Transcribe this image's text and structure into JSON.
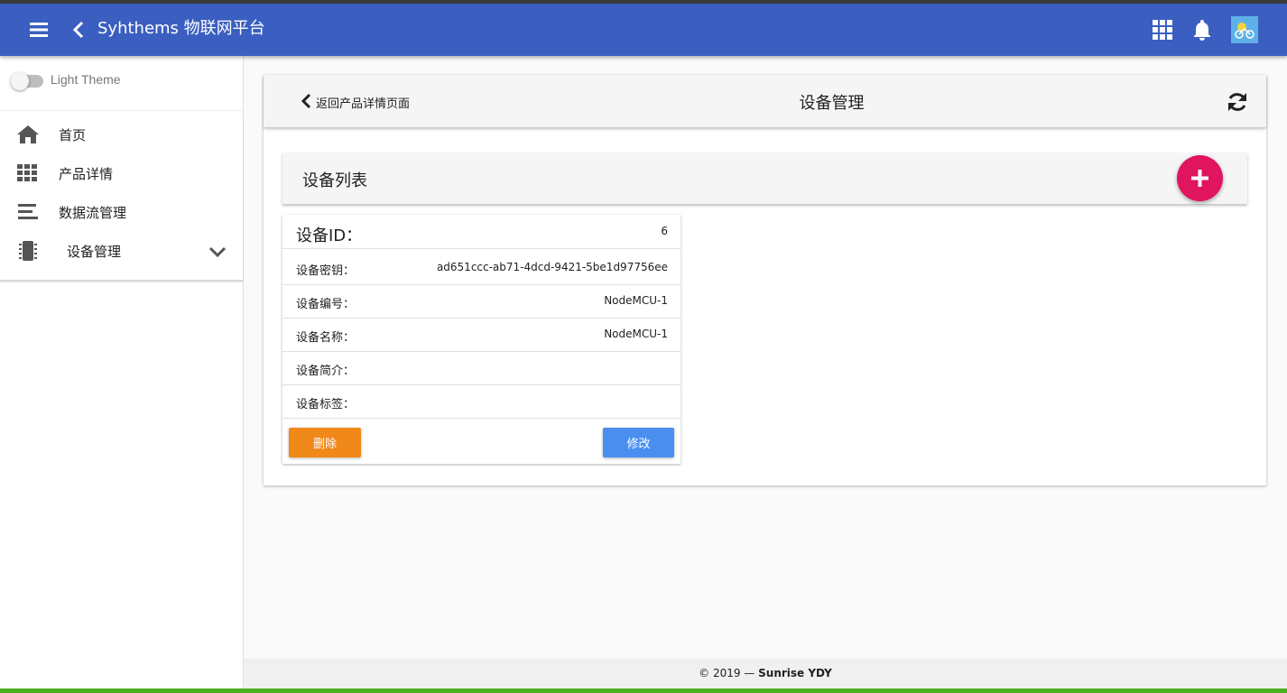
{
  "app": {
    "title": "Syhthems 物联网平台"
  },
  "colors": {
    "appbar": "#3b5fc0",
    "fab": "#e0145f",
    "delete": "#f1891a",
    "edit": "#4a8ff0"
  },
  "sidebar": {
    "theme_label": "Light Theme",
    "theme_on": false,
    "items": [
      {
        "label": "首页",
        "icon": "home-icon"
      },
      {
        "label": "产品详情",
        "icon": "grid-icon"
      },
      {
        "label": "数据流管理",
        "icon": "stream-icon"
      },
      {
        "label": "设备管理",
        "icon": "chip-icon"
      }
    ]
  },
  "page": {
    "back_label": "返回产品详情页面",
    "title": "设备管理"
  },
  "device_list": {
    "title": "设备列表",
    "card": {
      "id_label": "设备ID：",
      "id_value": "6",
      "rows": [
        {
          "label": "设备密钥：",
          "value": "ad651ccc-ab71-4dcd-9421-5be1d97756ee"
        },
        {
          "label": "设备编号：",
          "value": "NodeMCU-1"
        },
        {
          "label": "设备名称：",
          "value": "NodeMCU-1"
        },
        {
          "label": "设备简介：",
          "value": ""
        },
        {
          "label": "设备标签：",
          "value": ""
        }
      ],
      "delete_label": "删除",
      "edit_label": "修改"
    }
  },
  "footer": {
    "prefix": "© 2019 — ",
    "author": "Sunrise YDY"
  }
}
